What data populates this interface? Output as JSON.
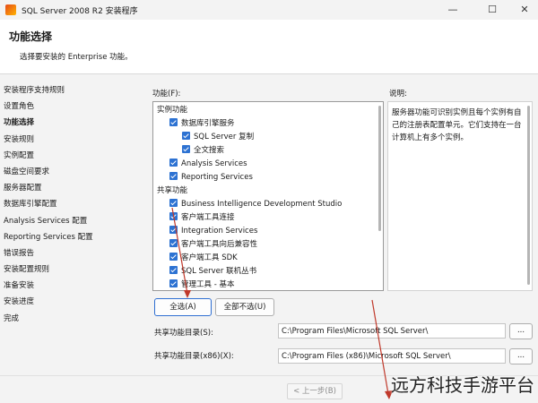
{
  "window": {
    "title": "SQL Server 2008 R2 安装程序",
    "minimize": "—",
    "maximize": "☐",
    "close": "✕"
  },
  "header": {
    "title": "功能选择",
    "subtitle": "选择要安装的 Enterprise 功能。"
  },
  "sidebar": {
    "items": [
      {
        "label": "安装程序支持规则"
      },
      {
        "label": "设置角色"
      },
      {
        "label": "功能选择"
      },
      {
        "label": "安装规则"
      },
      {
        "label": "实例配置"
      },
      {
        "label": "磁盘空间要求"
      },
      {
        "label": "服务器配置"
      },
      {
        "label": "数据库引擎配置"
      },
      {
        "label": "Analysis Services 配置"
      },
      {
        "label": "Reporting Services 配置"
      },
      {
        "label": "错误报告"
      },
      {
        "label": "安装配置规则"
      },
      {
        "label": "准备安装"
      },
      {
        "label": "安装进度"
      },
      {
        "label": "完成"
      }
    ],
    "active_index": 2
  },
  "features": {
    "label": "功能(F):",
    "items": [
      {
        "label": "实例功能",
        "checkbox": false,
        "checked": false
      },
      {
        "label": "数据库引擎服务",
        "checkbox": true,
        "checked": true
      },
      {
        "label": "SQL Server 复制",
        "checkbox": true,
        "checked": true
      },
      {
        "label": "全文搜索",
        "checkbox": true,
        "checked": true
      },
      {
        "label": "Analysis Services",
        "checkbox": true,
        "checked": true
      },
      {
        "label": "Reporting Services",
        "checkbox": true,
        "checked": true
      },
      {
        "label": "共享功能",
        "checkbox": false,
        "checked": false
      },
      {
        "label": "Business Intelligence Development Studio",
        "checkbox": true,
        "checked": true
      },
      {
        "label": "客户端工具连接",
        "checkbox": true,
        "checked": true
      },
      {
        "label": "Integration Services",
        "checkbox": true,
        "checked": true
      },
      {
        "label": "客户端工具向后兼容性",
        "checkbox": true,
        "checked": true
      },
      {
        "label": "客户端工具 SDK",
        "checkbox": true,
        "checked": true
      },
      {
        "label": "SQL Server 联机丛书",
        "checkbox": true,
        "checked": true
      },
      {
        "label": "管理工具 - 基本",
        "checkbox": true,
        "checked": true
      }
    ]
  },
  "description": {
    "label": "说明:",
    "text": "服务器功能可识别实例且每个实例有自己的注册表配置单元。它们支持在一台计算机上有多个实例。"
  },
  "buttons": {
    "select_all": "全选(A)",
    "unselect_all": "全部不选(U)",
    "browse": "..."
  },
  "shared_dir": {
    "label": "共享功能目录(S):",
    "value": "C:\\Program Files\\Microsoft SQL Server\\"
  },
  "shared_dir_x86": {
    "label": "共享功能目录(x86)(X):",
    "value": "C:\\Program Files (x86)\\Microsoft SQL Server\\"
  },
  "footer": {
    "back": "< 上一步(B)"
  },
  "watermark": "远方科技手游平台",
  "colors": {
    "accent": "#2d72d2",
    "annotation": "#c0392b"
  }
}
